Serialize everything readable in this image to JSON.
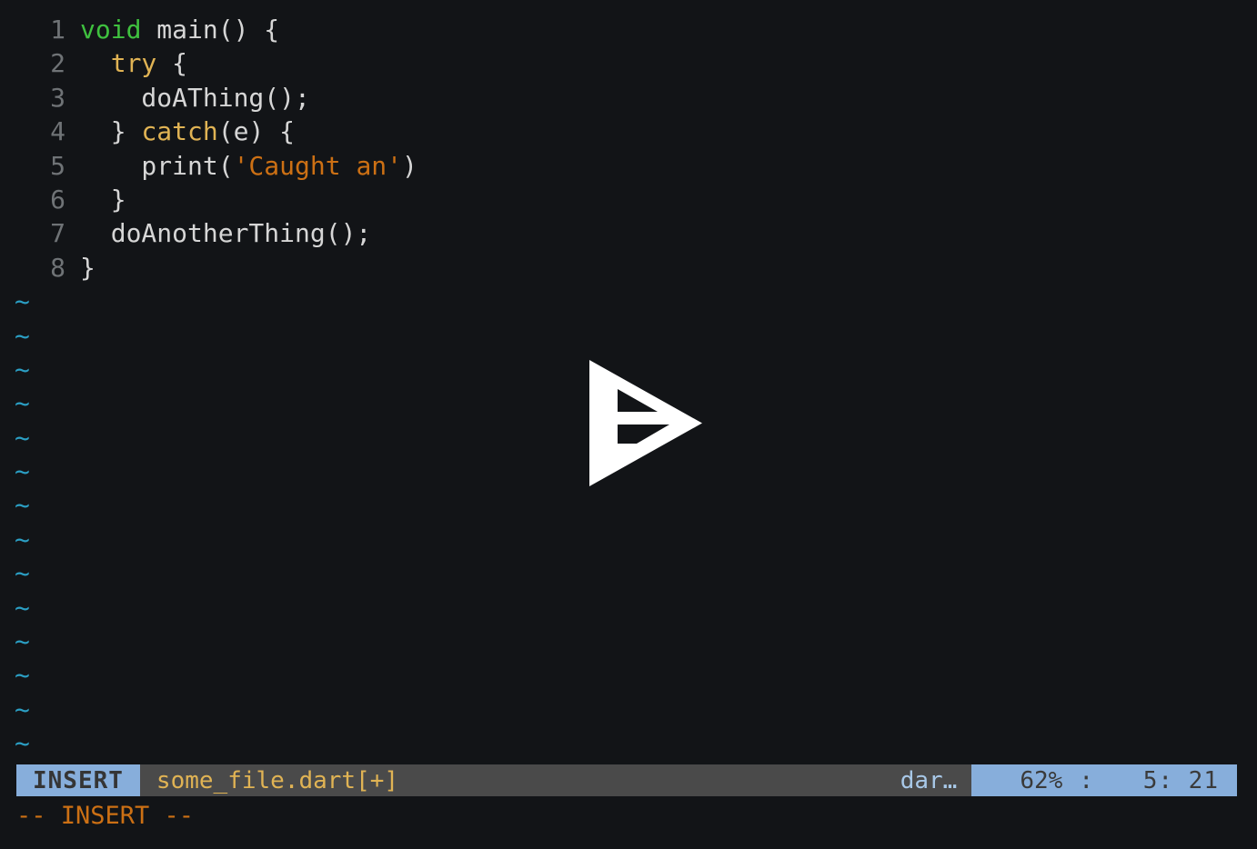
{
  "editor": {
    "app": "vim",
    "background_color": "#121417",
    "line_number_color": "#6f7376",
    "lines": [
      {
        "num": "1",
        "segments": [
          {
            "text": "void",
            "kind": "kw-green"
          },
          {
            "text": " main() {",
            "kind": "plain"
          }
        ]
      },
      {
        "num": "2",
        "segments": [
          {
            "text": "  ",
            "kind": "plain"
          },
          {
            "text": "try",
            "kind": "kw-yellow"
          },
          {
            "text": " {",
            "kind": "plain"
          }
        ]
      },
      {
        "num": "3",
        "segments": [
          {
            "text": "    doAThing();",
            "kind": "plain"
          }
        ]
      },
      {
        "num": "4",
        "segments": [
          {
            "text": "  } ",
            "kind": "plain"
          },
          {
            "text": "catch",
            "kind": "kw-yellow"
          },
          {
            "text": "(e) {",
            "kind": "plain"
          }
        ]
      },
      {
        "num": "5",
        "segments": [
          {
            "text": "    print(",
            "kind": "plain"
          },
          {
            "text": "'Caught an'",
            "kind": "str"
          },
          {
            "text": ")",
            "kind": "plain"
          }
        ]
      },
      {
        "num": "6",
        "segments": [
          {
            "text": "  }",
            "kind": "plain"
          }
        ]
      },
      {
        "num": "7",
        "segments": [
          {
            "text": "  doAnotherThing();",
            "kind": "plain"
          }
        ]
      },
      {
        "num": "8",
        "segments": [
          {
            "text": "}",
            "kind": "plain"
          }
        ]
      }
    ],
    "empty_marker": "~",
    "empty_marker_color": "#2b9fc4",
    "empty_marker_count": 14
  },
  "overlay": {
    "logo_name": "asciinema-play-logo",
    "logo_color": "#ffffff"
  },
  "statusline": {
    "mode": "INSERT",
    "mode_bg": "#87aedb",
    "mode_fg": "#353535",
    "filename": "some_file.dart[+]",
    "filename_color": "#e0b354",
    "filetype": "dar…",
    "filetype_color": "#a8c8e8",
    "bar_bg": "#4a4a4a",
    "percent": "62%",
    "separator": ":",
    "position": "5: 21",
    "right_bg": "#87aedb"
  },
  "message": {
    "text": "-- INSERT --",
    "color": "#cc7014"
  }
}
